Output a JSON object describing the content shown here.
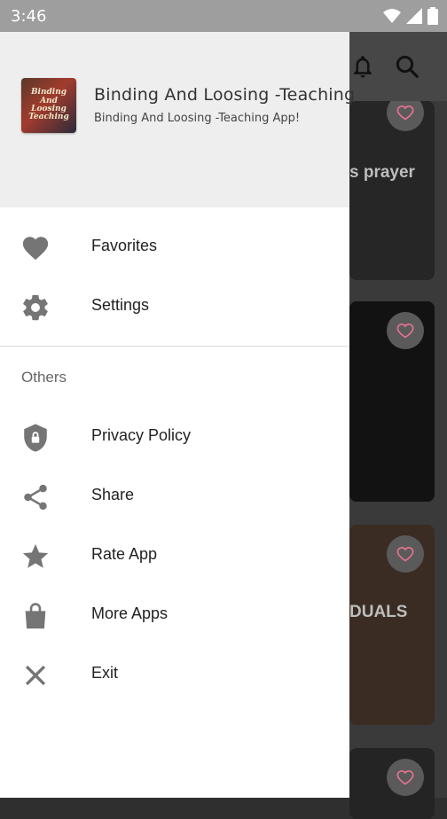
{
  "status_bar": {
    "time": "3:46"
  },
  "app": {
    "cards": [
      {
        "text": "s prayer"
      },
      {
        "text": ""
      },
      {
        "text": "DUALS"
      },
      {
        "text": ""
      }
    ]
  },
  "drawer": {
    "header": {
      "title": "Binding And Loosing -Teaching",
      "subtitle": "Binding And Loosing -Teaching App!",
      "logo_text": "Binding And Loosing Teaching"
    },
    "primary_items": [
      {
        "label": "Favorites",
        "icon": "heart-icon"
      },
      {
        "label": "Settings",
        "icon": "gear-icon"
      }
    ],
    "section_label": "Others",
    "other_items": [
      {
        "label": "Privacy Policy",
        "icon": "shield-lock-icon"
      },
      {
        "label": "Share",
        "icon": "share-icon"
      },
      {
        "label": "Rate App",
        "icon": "star-icon"
      },
      {
        "label": "More Apps",
        "icon": "shopping-bag-icon"
      },
      {
        "label": "Exit",
        "icon": "close-icon"
      }
    ]
  },
  "colors": {
    "icon_gray": "#757575",
    "heart_accent": "#e57390",
    "status_bar": "#9e9e9e",
    "drawer_header": "#eeeeee"
  }
}
